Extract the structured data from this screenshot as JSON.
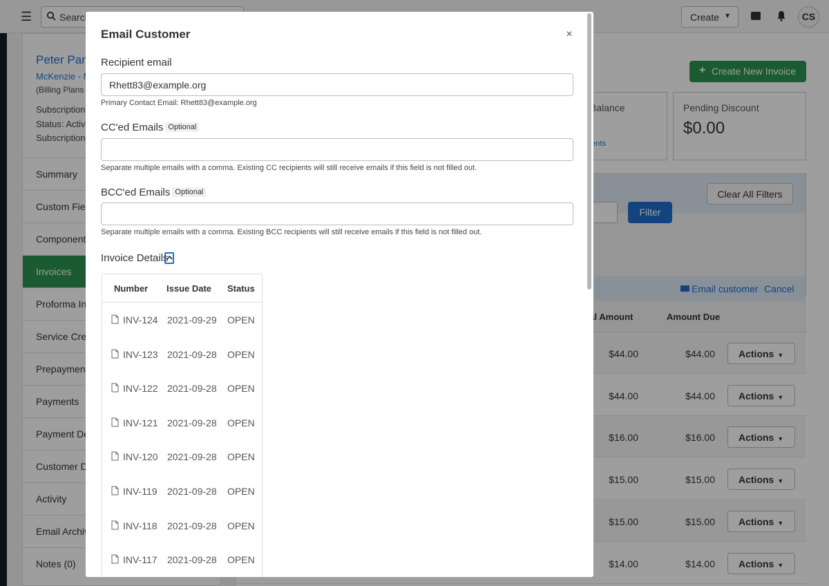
{
  "topbar": {
    "search_placeholder": "Search",
    "create_label": "Create",
    "avatar_initials": "CS"
  },
  "customer": {
    "name": "Peter Pan",
    "org": "McKenzie - M",
    "plan": "(Billing Plans",
    "subscription": "Subscription",
    "status": "Status: Active",
    "subscription2": "Subscription"
  },
  "sidebar": {
    "items": [
      {
        "label": "Summary",
        "active": false
      },
      {
        "label": "Custom Fields",
        "active": false
      },
      {
        "label": "Components",
        "active": false
      },
      {
        "label": "Invoices",
        "active": true
      },
      {
        "label": "Proforma Invoices",
        "active": false
      },
      {
        "label": "Service Credits",
        "active": false
      },
      {
        "label": "Prepayments",
        "active": false
      },
      {
        "label": "Payments",
        "active": false
      },
      {
        "label": "Payment Details",
        "active": false
      },
      {
        "label": "Customer Details",
        "active": false
      },
      {
        "label": "Activity",
        "active": false
      },
      {
        "label": "Email Archive",
        "active": false
      },
      {
        "label": "Notes (0)",
        "active": false
      }
    ]
  },
  "main": {
    "create_invoice_label": "Create New Invoice",
    "balance_label": "Balance",
    "balance_link": "ments",
    "pending_discount_label": "Pending Discount",
    "pending_discount_value": "$0.00",
    "clear_filters_label": "Clear All Filters",
    "filter_label": "Filter",
    "email_customer_label": "Email customer",
    "cancel_label": "Cancel",
    "col_total": "otal Amount",
    "col_due": "Amount Due",
    "actions_label": "Actions",
    "rows": [
      {
        "total": "$44.00",
        "due": "$44.00"
      },
      {
        "total": "$44.00",
        "due": "$44.00"
      },
      {
        "total": "$16.00",
        "due": "$16.00"
      },
      {
        "total": "$15.00",
        "due": "$15.00"
      },
      {
        "total": "$15.00",
        "due": "$15.00"
      },
      {
        "total": "$14.00",
        "due": "$14.00"
      }
    ]
  },
  "modal": {
    "title": "Email Customer",
    "close_symbol": "×",
    "recipient_label": "Recipient email",
    "recipient_value": "Rhett83@example.org",
    "recipient_hint": "Primary Contact Email: Rhett83@example.org",
    "cc_label": "CC'ed Emails",
    "cc_value": "",
    "optional_tag": "Optional",
    "cc_hint": "Separate multiple emails with a comma. Existing CC recipients will still receive emails if this field is not filled out.",
    "bcc_label": "BCC'ed Emails",
    "bcc_value": "",
    "bcc_hint": "Separate multiple emails with a comma. Existing BCC recipients will still receive emails if this field is not filled out.",
    "details_label": "Invoice Details",
    "table_headers": {
      "number": "Number",
      "issue_date": "Issue Date",
      "status": "Status"
    },
    "invoices": [
      {
        "number": "INV-124",
        "date": "2021-09-29",
        "status": "OPEN"
      },
      {
        "number": "INV-123",
        "date": "2021-09-28",
        "status": "OPEN"
      },
      {
        "number": "INV-122",
        "date": "2021-09-28",
        "status": "OPEN"
      },
      {
        "number": "INV-121",
        "date": "2021-09-28",
        "status": "OPEN"
      },
      {
        "number": "INV-120",
        "date": "2021-09-28",
        "status": "OPEN"
      },
      {
        "number": "INV-119",
        "date": "2021-09-28",
        "status": "OPEN"
      },
      {
        "number": "INV-118",
        "date": "2021-09-28",
        "status": "OPEN"
      },
      {
        "number": "INV-117",
        "date": "2021-09-28",
        "status": "OPEN"
      }
    ]
  },
  "colors": {
    "brand_green": "#2b9350",
    "link_blue": "#1f6fce"
  }
}
